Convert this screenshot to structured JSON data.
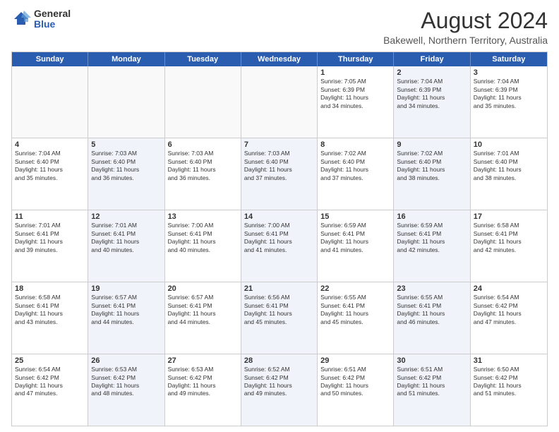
{
  "logo": {
    "general": "General",
    "blue": "Blue"
  },
  "title": "August 2024",
  "subtitle": "Bakewell, Northern Territory, Australia",
  "headers": [
    "Sunday",
    "Monday",
    "Tuesday",
    "Wednesday",
    "Thursday",
    "Friday",
    "Saturday"
  ],
  "weeks": [
    [
      {
        "day": "",
        "text": "",
        "empty": true
      },
      {
        "day": "",
        "text": "",
        "empty": true
      },
      {
        "day": "",
        "text": "",
        "empty": true
      },
      {
        "day": "",
        "text": "",
        "empty": true
      },
      {
        "day": "1",
        "text": "Sunrise: 7:05 AM\nSunset: 6:39 PM\nDaylight: 11 hours\nand 34 minutes.",
        "empty": false,
        "alt": false
      },
      {
        "day": "2",
        "text": "Sunrise: 7:04 AM\nSunset: 6:39 PM\nDaylight: 11 hours\nand 34 minutes.",
        "empty": false,
        "alt": true
      },
      {
        "day": "3",
        "text": "Sunrise: 7:04 AM\nSunset: 6:39 PM\nDaylight: 11 hours\nand 35 minutes.",
        "empty": false,
        "alt": false
      }
    ],
    [
      {
        "day": "4",
        "text": "Sunrise: 7:04 AM\nSunset: 6:40 PM\nDaylight: 11 hours\nand 35 minutes.",
        "empty": false,
        "alt": false
      },
      {
        "day": "5",
        "text": "Sunrise: 7:03 AM\nSunset: 6:40 PM\nDaylight: 11 hours\nand 36 minutes.",
        "empty": false,
        "alt": true
      },
      {
        "day": "6",
        "text": "Sunrise: 7:03 AM\nSunset: 6:40 PM\nDaylight: 11 hours\nand 36 minutes.",
        "empty": false,
        "alt": false
      },
      {
        "day": "7",
        "text": "Sunrise: 7:03 AM\nSunset: 6:40 PM\nDaylight: 11 hours\nand 37 minutes.",
        "empty": false,
        "alt": true
      },
      {
        "day": "8",
        "text": "Sunrise: 7:02 AM\nSunset: 6:40 PM\nDaylight: 11 hours\nand 37 minutes.",
        "empty": false,
        "alt": false
      },
      {
        "day": "9",
        "text": "Sunrise: 7:02 AM\nSunset: 6:40 PM\nDaylight: 11 hours\nand 38 minutes.",
        "empty": false,
        "alt": true
      },
      {
        "day": "10",
        "text": "Sunrise: 7:01 AM\nSunset: 6:40 PM\nDaylight: 11 hours\nand 38 minutes.",
        "empty": false,
        "alt": false
      }
    ],
    [
      {
        "day": "11",
        "text": "Sunrise: 7:01 AM\nSunset: 6:41 PM\nDaylight: 11 hours\nand 39 minutes.",
        "empty": false,
        "alt": false
      },
      {
        "day": "12",
        "text": "Sunrise: 7:01 AM\nSunset: 6:41 PM\nDaylight: 11 hours\nand 40 minutes.",
        "empty": false,
        "alt": true
      },
      {
        "day": "13",
        "text": "Sunrise: 7:00 AM\nSunset: 6:41 PM\nDaylight: 11 hours\nand 40 minutes.",
        "empty": false,
        "alt": false
      },
      {
        "day": "14",
        "text": "Sunrise: 7:00 AM\nSunset: 6:41 PM\nDaylight: 11 hours\nand 41 minutes.",
        "empty": false,
        "alt": true
      },
      {
        "day": "15",
        "text": "Sunrise: 6:59 AM\nSunset: 6:41 PM\nDaylight: 11 hours\nand 41 minutes.",
        "empty": false,
        "alt": false
      },
      {
        "day": "16",
        "text": "Sunrise: 6:59 AM\nSunset: 6:41 PM\nDaylight: 11 hours\nand 42 minutes.",
        "empty": false,
        "alt": true
      },
      {
        "day": "17",
        "text": "Sunrise: 6:58 AM\nSunset: 6:41 PM\nDaylight: 11 hours\nand 42 minutes.",
        "empty": false,
        "alt": false
      }
    ],
    [
      {
        "day": "18",
        "text": "Sunrise: 6:58 AM\nSunset: 6:41 PM\nDaylight: 11 hours\nand 43 minutes.",
        "empty": false,
        "alt": false
      },
      {
        "day": "19",
        "text": "Sunrise: 6:57 AM\nSunset: 6:41 PM\nDaylight: 11 hours\nand 44 minutes.",
        "empty": false,
        "alt": true
      },
      {
        "day": "20",
        "text": "Sunrise: 6:57 AM\nSunset: 6:41 PM\nDaylight: 11 hours\nand 44 minutes.",
        "empty": false,
        "alt": false
      },
      {
        "day": "21",
        "text": "Sunrise: 6:56 AM\nSunset: 6:41 PM\nDaylight: 11 hours\nand 45 minutes.",
        "empty": false,
        "alt": true
      },
      {
        "day": "22",
        "text": "Sunrise: 6:55 AM\nSunset: 6:41 PM\nDaylight: 11 hours\nand 45 minutes.",
        "empty": false,
        "alt": false
      },
      {
        "day": "23",
        "text": "Sunrise: 6:55 AM\nSunset: 6:41 PM\nDaylight: 11 hours\nand 46 minutes.",
        "empty": false,
        "alt": true
      },
      {
        "day": "24",
        "text": "Sunrise: 6:54 AM\nSunset: 6:42 PM\nDaylight: 11 hours\nand 47 minutes.",
        "empty": false,
        "alt": false
      }
    ],
    [
      {
        "day": "25",
        "text": "Sunrise: 6:54 AM\nSunset: 6:42 PM\nDaylight: 11 hours\nand 47 minutes.",
        "empty": false,
        "alt": false
      },
      {
        "day": "26",
        "text": "Sunrise: 6:53 AM\nSunset: 6:42 PM\nDaylight: 11 hours\nand 48 minutes.",
        "empty": false,
        "alt": true
      },
      {
        "day": "27",
        "text": "Sunrise: 6:53 AM\nSunset: 6:42 PM\nDaylight: 11 hours\nand 49 minutes.",
        "empty": false,
        "alt": false
      },
      {
        "day": "28",
        "text": "Sunrise: 6:52 AM\nSunset: 6:42 PM\nDaylight: 11 hours\nand 49 minutes.",
        "empty": false,
        "alt": true
      },
      {
        "day": "29",
        "text": "Sunrise: 6:51 AM\nSunset: 6:42 PM\nDaylight: 11 hours\nand 50 minutes.",
        "empty": false,
        "alt": false
      },
      {
        "day": "30",
        "text": "Sunrise: 6:51 AM\nSunset: 6:42 PM\nDaylight: 11 hours\nand 51 minutes.",
        "empty": false,
        "alt": true
      },
      {
        "day": "31",
        "text": "Sunrise: 6:50 AM\nSunset: 6:42 PM\nDaylight: 11 hours\nand 51 minutes.",
        "empty": false,
        "alt": false
      }
    ]
  ]
}
